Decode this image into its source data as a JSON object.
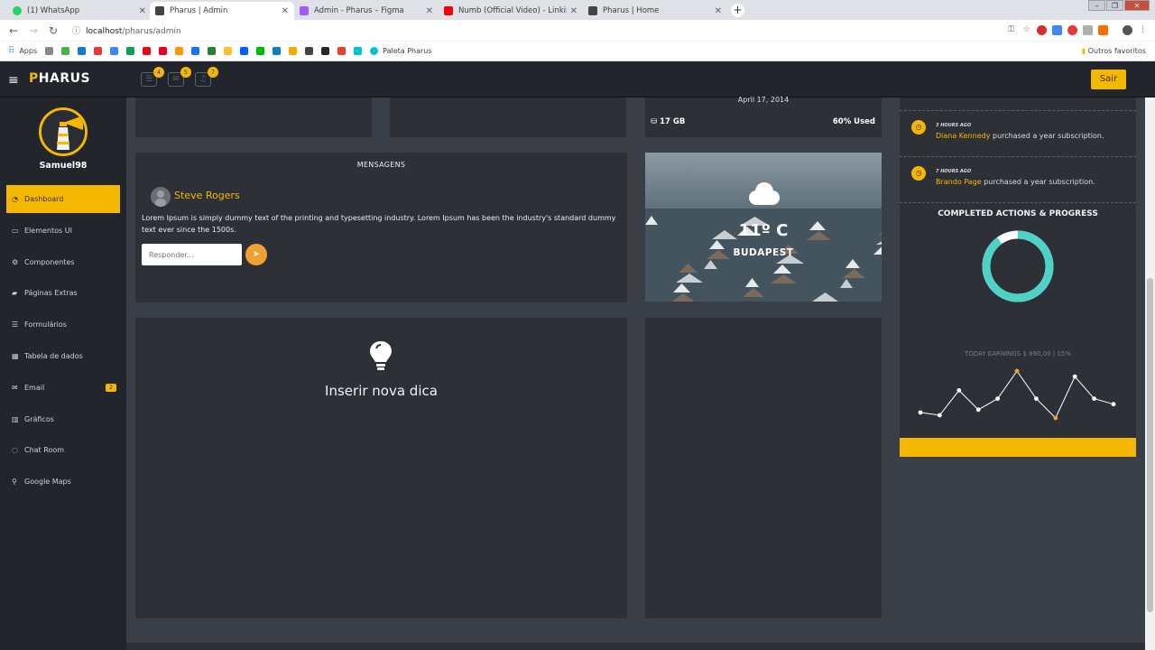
{
  "browser": {
    "tabs": [
      {
        "title": "(1) WhatsApp",
        "color": "#25d366"
      },
      {
        "title": "Pharus | Admin",
        "color": "#444444"
      },
      {
        "title": "Admin - Pharus – Figma",
        "color": "#a259ff"
      },
      {
        "title": "Numb (Official Video) - Linkin Pa...",
        "color": "#ff0000"
      },
      {
        "title": "Pharus | Home",
        "color": "#444444"
      }
    ],
    "url_host": "localhost",
    "url_path": "/pharus/admin",
    "bookmarks_apps": "Apps",
    "bookmark_paleta": "Paleta Pharus",
    "bookmarks_other": "Outros favoritos",
    "bookmark_colors": [
      "#888888",
      "#4caf50",
      "#1976d2",
      "#e53935",
      "#4285f4",
      "#0f9d58",
      "#e50914",
      "#e60023",
      "#ff9900",
      "#1a73e8",
      "#2e7d32",
      "#fbc02d",
      "#0061fe",
      "#00b900",
      "#0f7dc2",
      "#e9b000",
      "#444444",
      "#24292e",
      "#e44332",
      "#00c4cc"
    ]
  },
  "header": {
    "logo_accent": "P",
    "logo_rest": "HARUS",
    "badges": [
      "4",
      "5",
      "7"
    ],
    "logout_label": "Sair"
  },
  "sidebar": {
    "username": "Samuel98",
    "items": [
      {
        "label": "Dashboard",
        "icon": "dashboard-icon",
        "glyph": "◔"
      },
      {
        "label": "Elementos UI",
        "icon": "desktop-icon",
        "glyph": "▭"
      },
      {
        "label": "Componentes",
        "icon": "cogs-icon",
        "glyph": "⚙"
      },
      {
        "label": "Páginas Extras",
        "icon": "book-icon",
        "glyph": "▰"
      },
      {
        "label": "Formulários",
        "icon": "list-icon",
        "glyph": "☰"
      },
      {
        "label": "Tabela de dados",
        "icon": "table-icon",
        "glyph": "▦"
      },
      {
        "label": "Email",
        "icon": "envelope-icon",
        "glyph": "✉",
        "badge": "2"
      },
      {
        "label": "Gráficos",
        "icon": "bar-chart-icon",
        "glyph": "▥"
      },
      {
        "label": "Chat Room",
        "icon": "comments-icon",
        "glyph": "◌"
      },
      {
        "label": "Google Maps",
        "icon": "map-marker-icon",
        "glyph": "⚲"
      }
    ]
  },
  "messages": {
    "title": "MENSAGENS",
    "sender": "Steve Rogers",
    "body": "Lorem Ipsum is simply dummy text of the printing and typesetting industry. Lorem Ipsum has been the industry's standard dummy text ever since the 1500s.",
    "reply_placeholder": "Responder..."
  },
  "tip": {
    "label": "Inserir nova dica"
  },
  "storage": {
    "date": "April 17, 2014",
    "size": "17 GB",
    "used": "60% Used"
  },
  "weather": {
    "temp": "11º C",
    "city": "BUDAPEST"
  },
  "activity": {
    "items": [
      {
        "time": "3 HOURS AGO",
        "name": "Diana Kennedy",
        "text": " purchased a year subscription."
      },
      {
        "time": "7 HOURS AGO",
        "name": "Brando Page",
        "text": " purchased a year subscription."
      }
    ],
    "progress_title": "COMPLETED ACTIONS & PROGRESS",
    "progress_fraction": 0.9,
    "earnings_label": "TODAY EARNINGS $ 890,00 | 15%",
    "sparkline": [
      4,
      3,
      12,
      5,
      9,
      19,
      9,
      2,
      17,
      9,
      7
    ],
    "sparkline_highlight": [
      5,
      7
    ]
  },
  "colors": {
    "accent": "#f5b800",
    "panel": "#2d3037",
    "teal": "#4fd1c5"
  }
}
